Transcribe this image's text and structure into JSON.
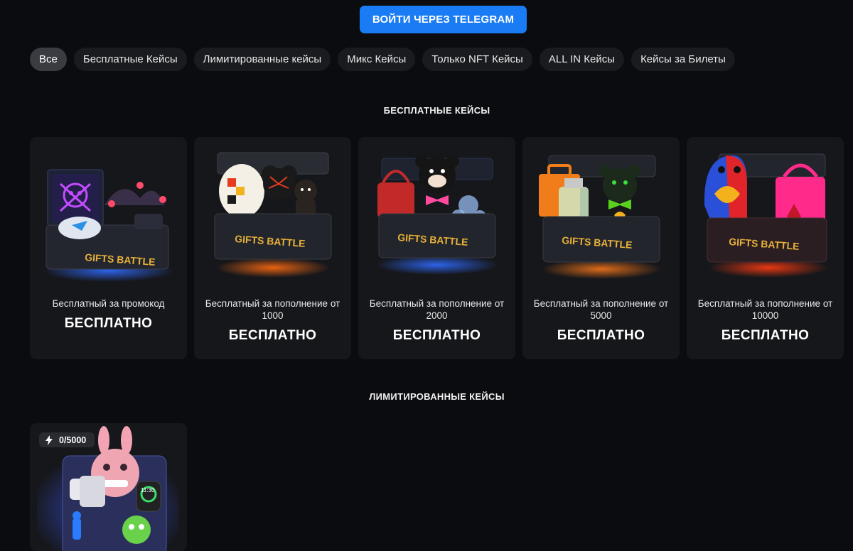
{
  "header": {
    "login_button": "ВОЙТИ ЧЕРЕЗ TELEGRAM"
  },
  "tabs": [
    {
      "label": "Все",
      "active": true
    },
    {
      "label": "Бесплатные Кейсы",
      "active": false
    },
    {
      "label": "Лимитированные кейсы",
      "active": false
    },
    {
      "label": "Микс Кейсы",
      "active": false
    },
    {
      "label": "Только NFT Кейсы",
      "active": false
    },
    {
      "label": "ALL IN Кейсы",
      "active": false
    },
    {
      "label": "Кейсы за Билеты",
      "active": false
    }
  ],
  "sections": {
    "free": {
      "title": "БЕСПЛАТНЫЕ КЕЙСЫ",
      "cases": [
        {
          "name": "Бесплатный за промокод",
          "price": "БЕСПЛАТНО",
          "crate_label": "GIFTS BATTLE",
          "glow": "#2f6bff"
        },
        {
          "name": "Бесплатный за пополнение от 1000",
          "price": "БЕСПЛАТНО",
          "crate_label": "GIFTS BATTLE",
          "glow": "#ff6a10"
        },
        {
          "name": "Бесплатный за пополнение от 2000",
          "price": "БЕСПЛАТНО",
          "crate_label": "GIFTS BATTLE",
          "glow": "#2f6bff"
        },
        {
          "name": "Бесплатный за пополнение от 5000",
          "price": "БЕСПЛАТНО",
          "crate_label": "GIFTS BATTLE",
          "glow": "#ff7a18"
        },
        {
          "name": "Бесплатный за пополнение от 10000",
          "price": "БЕСПЛАТНО",
          "crate_label": "GIFTS BATTLE",
          "glow": "#ff3b10"
        }
      ]
    },
    "limited": {
      "title": "ЛИМИТИРОВАННЫЕ КЕЙСЫ",
      "cases": [
        {
          "counter": "0/5000",
          "watch_time": "11:30",
          "glow": "#3f5cff"
        }
      ]
    }
  },
  "colors": {
    "accent": "#1a7cf5",
    "background": "#0b0c0f",
    "card": "#16171b",
    "tab": "#1a1b1f",
    "tab_active": "#3b3c42",
    "crate_text": "#e8b13a"
  },
  "icons": {
    "counter_icon": "lightning-icon"
  }
}
